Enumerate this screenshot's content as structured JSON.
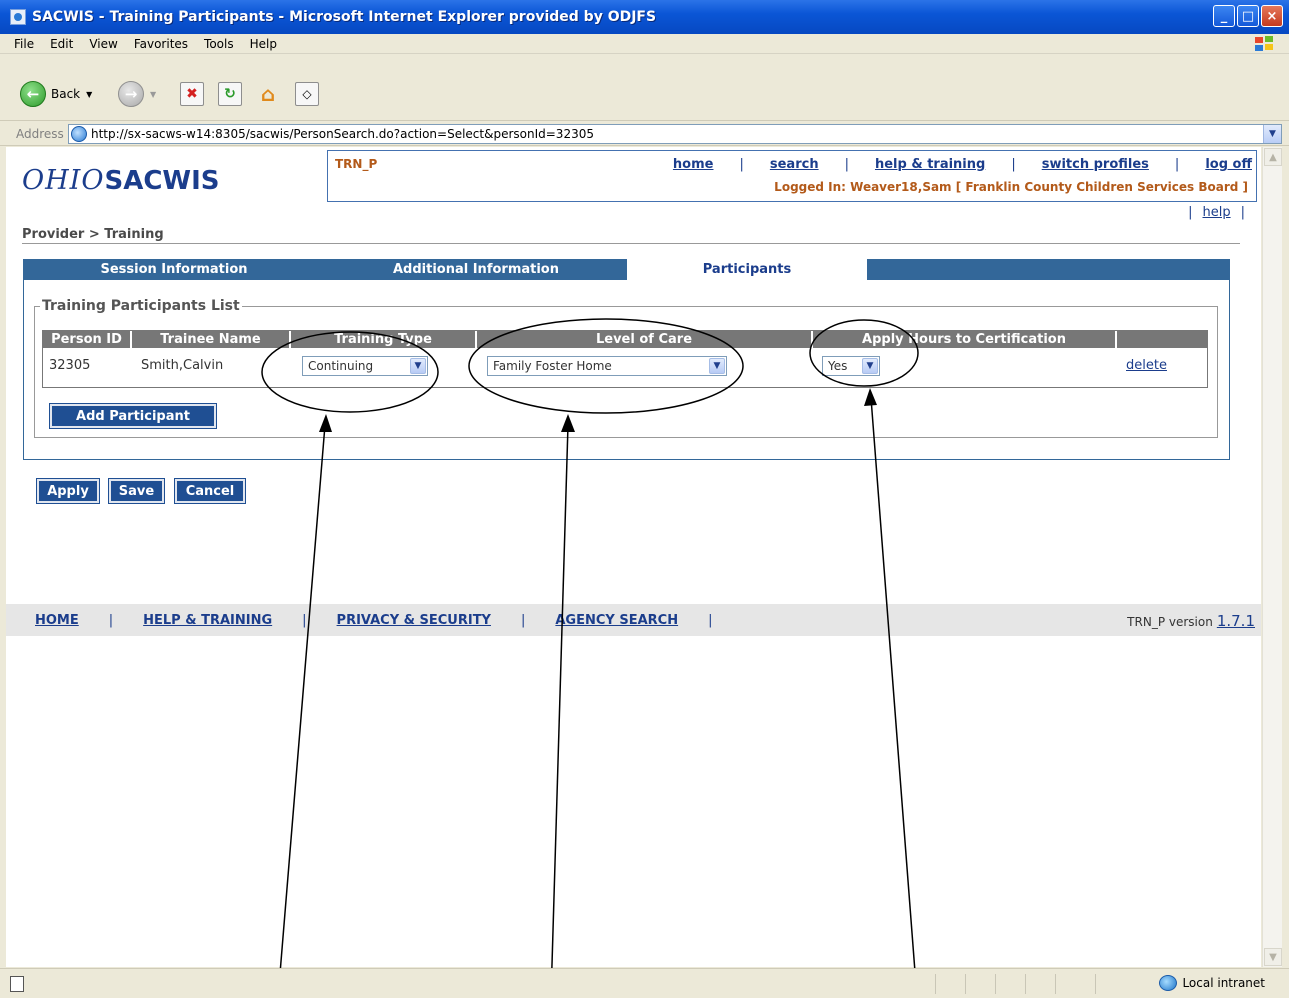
{
  "window": {
    "title": "SACWIS - Training Participants - Microsoft Internet Explorer provided by ODJFS",
    "controls": [
      "_",
      "□",
      "×"
    ]
  },
  "menu": [
    "File",
    "Edit",
    "View",
    "Favorites",
    "Tools",
    "Help"
  ],
  "toolbar": {
    "back_label": "Back",
    "icons": [
      "back-icon",
      "forward-icon",
      "stop-icon",
      "refresh-icon",
      "home-icon",
      "media-icon"
    ]
  },
  "address": {
    "label": "Address",
    "url": "http://sx-sacws-w14:8305/sacwis/PersonSearch.do?action=Select&personId=32305"
  },
  "header": {
    "logo_ohio": "OHIO",
    "logo_sacwis": "SACWIS",
    "env_code": "TRN_P",
    "nav": [
      "home",
      "search",
      "help & training",
      "switch profiles",
      "log off"
    ],
    "logged_in": "Logged In:  Weaver18,Sam [ Franklin County Children Services Board ]",
    "help": "help"
  },
  "breadcrumb": "Provider > Training",
  "tabs": [
    {
      "label": "Session Information",
      "active": false
    },
    {
      "label": "Additional Information",
      "active": false
    },
    {
      "label": "Participants",
      "active": true
    }
  ],
  "participants": {
    "legend": "Training Participants List",
    "columns": [
      "Person ID",
      "Trainee Name",
      "Training Type",
      "Level of Care",
      "Apply Hours to Certification"
    ],
    "rows": [
      {
        "person_id": "32305",
        "trainee_name": "Smith,Calvin",
        "training_type": "Continuing",
        "level_of_care": "Family Foster Home",
        "apply_hours": "Yes",
        "action": "delete"
      }
    ],
    "add_button": "Add Participant"
  },
  "actions": {
    "apply": "Apply",
    "save": "Save",
    "cancel": "Cancel"
  },
  "footer": {
    "links": [
      "HOME",
      "HELP & TRAINING",
      "PRIVACY & SECURITY",
      "AGENCY SEARCH"
    ],
    "version_label": "TRN_P version",
    "version": "1.7.1"
  },
  "statusbar": {
    "zone": "Local intranet"
  },
  "colors": {
    "brand_blue": "#1b3d8c",
    "tab_bar": "#336799",
    "accent_orange": "#b35a1a",
    "button_blue": "#1f4f93"
  }
}
